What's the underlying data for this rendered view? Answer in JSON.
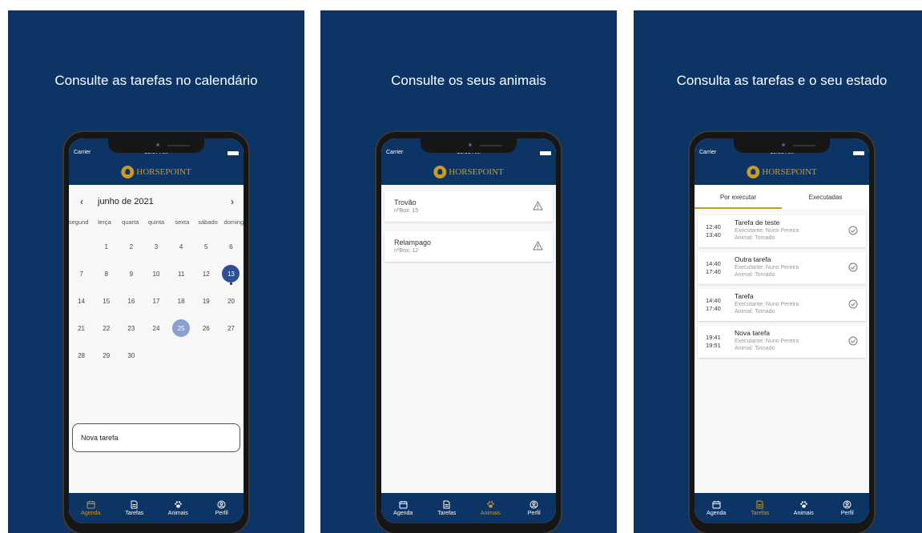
{
  "panels": [
    {
      "title": "Consulte as tarefas no calendário",
      "status": {
        "carrier": "Carrier",
        "time": "10:07 AM"
      },
      "brand": "HORSEPOINT",
      "calendar": {
        "month": "junho de 2021",
        "weekdays": [
          "segund",
          "terça",
          "quarta",
          "quinta",
          "sexta",
          "sábado",
          "doming"
        ],
        "days": [
          "",
          "1",
          "2",
          "3",
          "4",
          "5",
          "6",
          "7",
          "8",
          "9",
          "10",
          "11",
          "12",
          "13",
          "14",
          "15",
          "16",
          "17",
          "18",
          "19",
          "20",
          "21",
          "22",
          "23",
          "24",
          "25",
          "26",
          "27",
          "28",
          "29",
          "30",
          "",
          "",
          "",
          ""
        ],
        "today": "13",
        "selected": "25"
      },
      "new_task": "Nova tarefa",
      "tabs": [
        "Agenda",
        "Tarefas",
        "Animais",
        "Perfil"
      ],
      "active_tab": "Agenda"
    },
    {
      "title": "Consulte os seus animais",
      "status": {
        "carrier": "Carrier",
        "time": "10:09 AM"
      },
      "brand": "HORSEPOINT",
      "animals": [
        {
          "name": "Trovão",
          "box": "nºBox: 15"
        },
        {
          "name": "Relampago",
          "box": "nºBox: 12"
        }
      ],
      "tabs": [
        "Agenda",
        "Tarefas",
        "Animais",
        "Perfil"
      ],
      "active_tab": "Animais"
    },
    {
      "title": "Consulta as tarefas e o seu estado",
      "status": {
        "carrier": "Carrier",
        "time": "10:09 AM"
      },
      "brand": "HORSEPOINT",
      "segments": [
        "Por executar",
        "Executadas"
      ],
      "tasks": [
        {
          "start": "12:40",
          "end": "13:40",
          "title": "Tarefa de teste",
          "executor": "Executante: Nuno Pereira",
          "animal": "Animal: Tornado"
        },
        {
          "start": "14:40",
          "end": "17:40",
          "title": "Outra tarefa",
          "executor": "Executante: Nuno Pereira",
          "animal": "Animal: Tornado"
        },
        {
          "start": "14:40",
          "end": "17:40",
          "title": "Tarefa",
          "executor": "Executante: Nuno Pereira",
          "animal": "Animal: Tornado"
        },
        {
          "start": "19:41",
          "end": "19:51",
          "title": "Nova tarefa",
          "executor": "Executante: Nuno Pereira",
          "animal": "Animal: Tornado"
        }
      ],
      "tabs": [
        "Agenda",
        "Tarefas",
        "Animais",
        "Perfil"
      ],
      "active_tab": "Tarefas"
    }
  ],
  "colors": {
    "navy": "#0c3464",
    "gold": "#c89a2e",
    "today": "#2d4f95",
    "selected": "#8b9fd0"
  }
}
